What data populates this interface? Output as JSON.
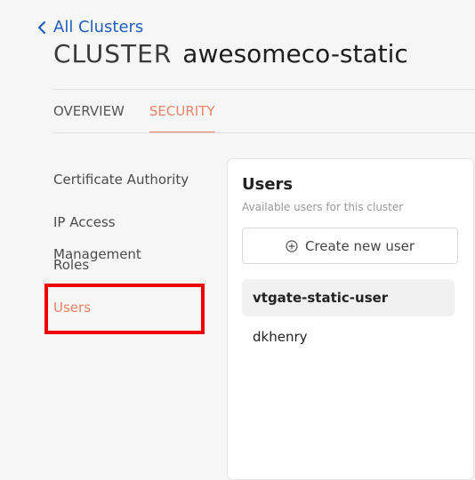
{
  "nav": {
    "back_label": "All Clusters"
  },
  "header": {
    "kind": "CLUSTER",
    "name": "awesomeco-static"
  },
  "tabs": [
    {
      "label": "OVERVIEW",
      "active": false
    },
    {
      "label": "SECURITY",
      "active": true
    }
  ],
  "sidebar": {
    "items": [
      {
        "label": "Certificate Authority"
      },
      {
        "label": "IP Access Management"
      },
      {
        "label": "Roles"
      },
      {
        "label": "Users"
      }
    ]
  },
  "panel": {
    "title": "Users",
    "subtitle": "Available users for this cluster",
    "create_label": "Create new user",
    "users": [
      {
        "name": "vtgate-static-user",
        "selected": true
      },
      {
        "name": "dkhenry",
        "selected": false
      }
    ]
  },
  "colors": {
    "link": "#1f5fbf",
    "accent": "#e8826a",
    "highlight": "#ee0000"
  }
}
